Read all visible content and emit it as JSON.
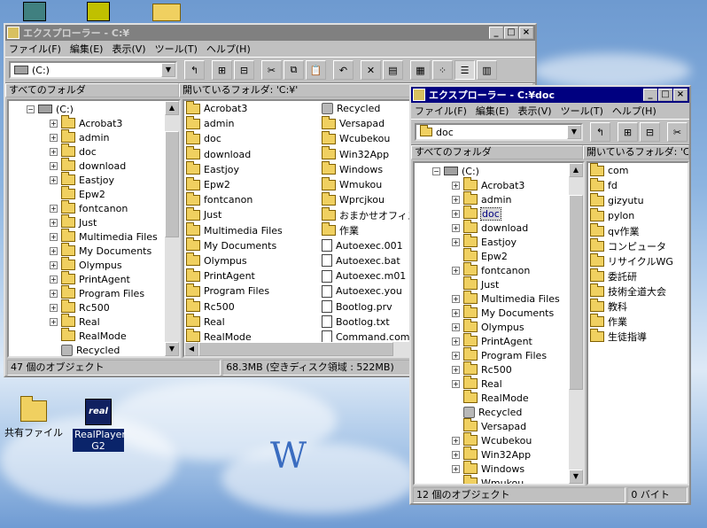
{
  "desktop": {
    "icons": [
      {
        "label": "共有ファイル"
      },
      {
        "label": "RealPlayer G2",
        "badge": "real"
      }
    ],
    "watermark": "W"
  },
  "explorer_c": {
    "title": "エクスプローラー - C:¥",
    "menu": [
      "ファイル(F)",
      "編集(E)",
      "表示(V)",
      "ツール(T)",
      "ヘルプ(H)"
    ],
    "address": "(C:)",
    "left_header": "すべてのフォルダ",
    "right_header": "開いているフォルダ: 'C:¥'",
    "tree_root": "(C:)",
    "tree": [
      "Acrobat3",
      "admin",
      "doc",
      "download",
      "Eastjoy",
      "Epw2",
      "fontcanon",
      "Just",
      "Multimedia Files",
      "My Documents",
      "Olympus",
      "PrintAgent",
      "Program Files",
      "Rc500",
      "Real",
      "RealMode",
      "Recycled"
    ],
    "files_col1": [
      "Acrobat3",
      "admin",
      "doc",
      "download",
      "Eastjoy",
      "Epw2",
      "fontcanon",
      "Just",
      "Multimedia Files",
      "My Documents",
      "Olympus",
      "PrintAgent",
      "Program Files",
      "Rc500",
      "Real",
      "RealMode"
    ],
    "files_col2": [
      "Recycled",
      "Versapad",
      "Wcubekou",
      "Win32App",
      "Windows",
      "Wmukou",
      "Wprcjkou",
      "おまかせオフィス",
      "作業",
      "Autoexec.001",
      "Autoexec.bat",
      "Autoexec.m01",
      "Autoexec.you",
      "Bootlog.prv",
      "Bootlog.txt",
      "Command.com"
    ],
    "status_count": "47 個のオブジェクト",
    "status_size": "68.3MB (空きディスク領域 : 522MB)"
  },
  "explorer_doc": {
    "title": "エクスプローラー - C:¥doc",
    "menu": [
      "ファイル(F)",
      "編集(E)",
      "表示(V)",
      "ツール(T)",
      "ヘルプ(H)"
    ],
    "address": "doc",
    "left_header": "すべてのフォルダ",
    "right_header": "開いているフォルダ: 'C:¥doc'",
    "tree_root": "(C:)",
    "tree": [
      "Acrobat3",
      "admin",
      "doc",
      "download",
      "Eastjoy",
      "Epw2",
      "fontcanon",
      "Just",
      "Multimedia Files",
      "My Documents",
      "Olympus",
      "PrintAgent",
      "Program Files",
      "Rc500",
      "Real",
      "RealMode",
      "Recycled",
      "Versapad",
      "Wcubekou",
      "Win32App",
      "Windows",
      "Wmukou"
    ],
    "files": [
      "com",
      "fd",
      "gizyutu",
      "pylon",
      "qv作業",
      "コンピュータ",
      "リサイクルWG",
      "委託研",
      "技術全道大会",
      "教科",
      "作業",
      "生徒指導"
    ],
    "status_count": "12 個のオブジェクト",
    "status_size": "0 バイト"
  }
}
